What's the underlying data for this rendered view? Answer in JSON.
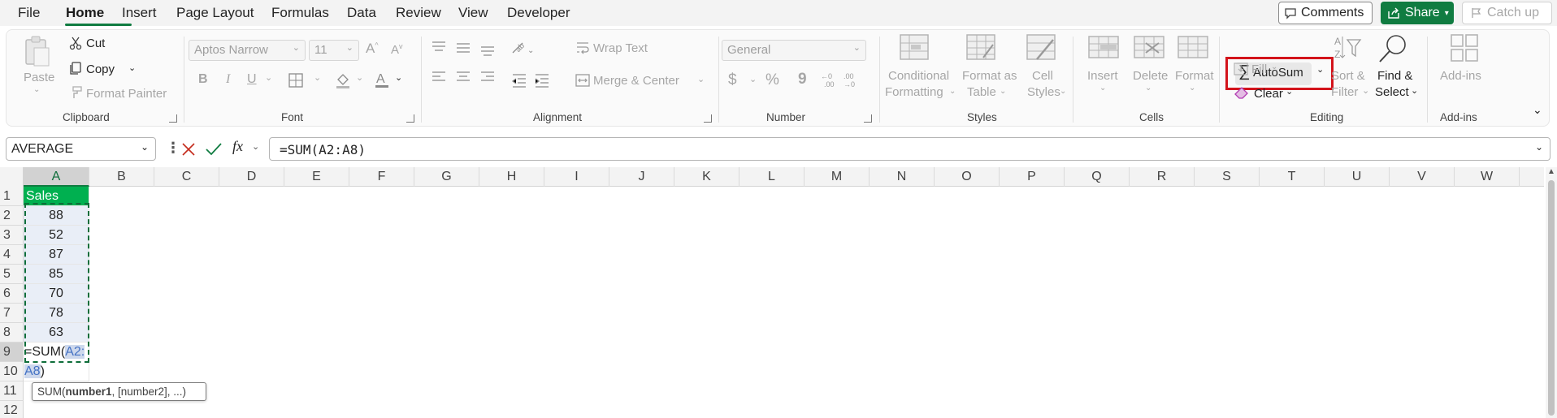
{
  "menu": {
    "tabs": [
      "File",
      "Home",
      "Insert",
      "Page Layout",
      "Formulas",
      "Data",
      "Review",
      "View",
      "Developer"
    ],
    "active": "Home",
    "comments_label": "Comments",
    "share_label": "Share",
    "catchup_label": "Catch up"
  },
  "ribbon": {
    "clipboard": {
      "paste": "Paste",
      "cut": "Cut",
      "copy": "Copy",
      "format_painter": "Format Painter",
      "label": "Clipboard"
    },
    "font": {
      "font_name": "Aptos Narrow",
      "font_size": "11",
      "bold": "B",
      "italic": "I",
      "underline": "U",
      "label": "Font"
    },
    "alignment": {
      "wrap_text": "Wrap Text",
      "merge_center": "Merge & Center",
      "label": "Alignment"
    },
    "number": {
      "format": "General",
      "currency": "$",
      "percent": "%",
      "comma": "9",
      "label": "Number"
    },
    "styles": {
      "conditional": [
        "Conditional",
        "Formatting"
      ],
      "format_table": [
        "Format as",
        "Table"
      ],
      "cell_styles": [
        "Cell",
        "Styles"
      ],
      "label": "Styles"
    },
    "cells": {
      "insert": "Insert",
      "delete": "Delete",
      "format": "Format",
      "label": "Cells"
    },
    "editing": {
      "autosum": "AutoSum",
      "fill": "Fill",
      "clear": "Clear",
      "sort_filter": [
        "Sort &",
        "Filter"
      ],
      "find_select": [
        "Find &",
        "Select"
      ],
      "label": "Editing"
    },
    "addins": {
      "addins": "Add-ins",
      "label": "Add-ins"
    }
  },
  "formula_bar": {
    "name_box": "AVERAGE",
    "fx": "fx",
    "formula": "=SUM(A2:A8)"
  },
  "grid": {
    "columns": [
      "A",
      "B",
      "C",
      "D",
      "E",
      "F",
      "G",
      "H",
      "I",
      "J",
      "K",
      "L",
      "M",
      "N",
      "O",
      "P",
      "Q",
      "R",
      "S",
      "T",
      "U",
      "V",
      "W"
    ],
    "rows": [
      "1",
      "2",
      "3",
      "4",
      "5",
      "6",
      "7",
      "8",
      "9",
      "10",
      "11",
      "12"
    ],
    "header_cell": "Sales",
    "values": [
      "88",
      "52",
      "87",
      "85",
      "70",
      "78",
      "63"
    ],
    "editing_cell": {
      "prefix": "=SUM(",
      "ref_part1": "A2:",
      "ref_part2": "A8",
      "suffix": ")"
    }
  },
  "tooltip": {
    "fn": "SUM(",
    "arg1": "number1",
    "rest": ", [number2], ...)"
  },
  "colors": {
    "accent": "#107c41",
    "header_fill": "#00b050",
    "highlight": "#d3131b"
  }
}
